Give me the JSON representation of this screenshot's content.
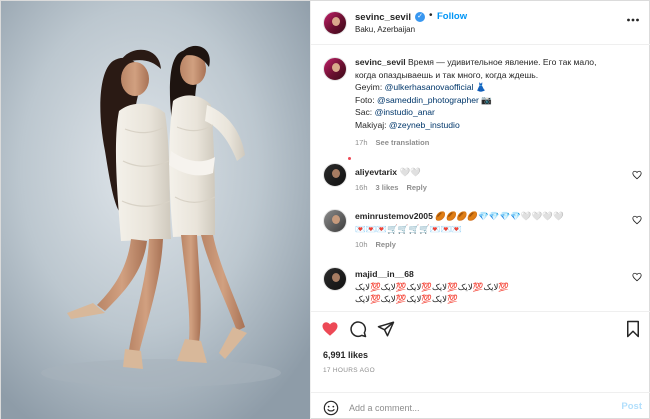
{
  "post": {
    "username": "sevinc_sevil",
    "follow_label": "Follow",
    "separator": "•",
    "location": "Baku, Azerbaijan",
    "more_icon": "more-horizontal-icon"
  },
  "caption": {
    "username": "sevinc_sevil",
    "text_line1": "Время — удивительное явление. Его так мало,",
    "text_line2": "когда опаздываешь и так много, когда ждешь.",
    "geyim_label": "Geyim: ",
    "geyim_mention": "@ulkerhasanovaofficial",
    "geyim_emoji": "👗",
    "foto_label": "Foto: ",
    "foto_mention": "@sameddin_photographer",
    "foto_emoji": "📷",
    "sac_label": "Sac: ",
    "sac_mention": "@instudio_anar",
    "makiyaj_label": "Makiyaj: ",
    "makiyaj_mention": "@zeyneb_instudio",
    "time": "17h",
    "see_translation": "See translation"
  },
  "comments": [
    {
      "username": "aliyevtarix",
      "text": "🤍🤍",
      "time": "16h",
      "likes": "3 likes",
      "reply": "Reply"
    },
    {
      "username": "eminrustemov2005",
      "text_line1": "🏉🏉🏉🏉💎💎💎💎🤍🤍🤍🤍",
      "text_line2": "💌💌💌🛒🛒🛒🛒💌💌💌",
      "time": "10h",
      "reply": "Reply"
    },
    {
      "username": "majid__in__68",
      "text_line1": "لایک💯لایک💯لایک💯لایک💯لایک💯لایک💯",
      "text_line2": "لایک💯لایک💯لایک💯لایک💯"
    }
  ],
  "actions": {
    "like_icon": "heart-filled-icon",
    "comment_icon": "comment-icon",
    "share_icon": "share-icon",
    "save_icon": "bookmark-icon",
    "likes_count": "6,991 likes",
    "time_ago": "17 HOURS AGO"
  },
  "add_comment": {
    "placeholder": "Add a comment...",
    "post_label": "Post",
    "emoji_icon": "smiley-icon"
  },
  "colors": {
    "accent_blue": "#0095f6",
    "like_red": "#ed4956",
    "mention_blue": "#00376b",
    "muted_gray": "#8e8e8e",
    "verified_blue": "#3897f0"
  }
}
